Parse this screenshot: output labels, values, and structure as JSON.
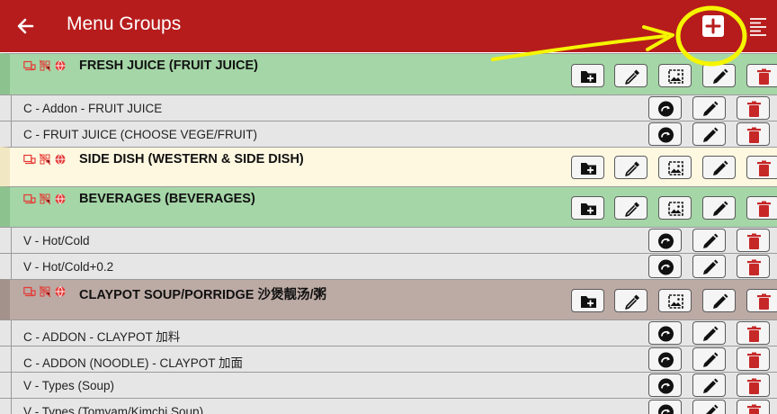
{
  "header": {
    "title": "Menu Groups",
    "back_icon": "arrow-left-icon",
    "add_icon": "plus-box-icon",
    "sort_icon": "sort-lines-icon"
  },
  "colors": {
    "toolbar": "#b71c1c",
    "group_green": "#a5d6a7",
    "group_cream": "#fff8e1",
    "group_taupe": "#bcaaa4",
    "delete": "#c62828",
    "annotation": "#f5f500"
  },
  "rows": [
    {
      "kind": "group",
      "label": "FRESH JUICE  (FRUIT JUICE)"
    },
    {
      "kind": "sub",
      "label": "C - Addon - FRUIT JUICE"
    },
    {
      "kind": "sub",
      "label": "C - FRUIT JUICE (CHOOSE VEGE/FRUIT)"
    },
    {
      "kind": "group",
      "label": "SIDE DISH  (WESTERN & SIDE DISH)"
    },
    {
      "kind": "group",
      "label": "BEVERAGES  (BEVERAGES)"
    },
    {
      "kind": "sub",
      "label": "V - Hot/Cold"
    },
    {
      "kind": "sub",
      "label": "V - Hot/Cold+0.2"
    },
    {
      "kind": "group",
      "label": "CLAYPOT SOUP/PORRIDGE 沙煲靓汤/粥"
    },
    {
      "kind": "sub",
      "label": "C - ADDON - CLAYPOT 加料"
    },
    {
      "kind": "sub",
      "label": "C - ADDON (NOODLE) - CLAYPOT 加面"
    },
    {
      "kind": "sub",
      "label": "V - Types (Soup)"
    },
    {
      "kind": "sub",
      "label": "V - Types (Tomyam/Kimchi Soup)"
    }
  ],
  "icons": {
    "group_status": [
      "pos-terminal-icon",
      "qr-code-icon",
      "globe-icon"
    ],
    "group_actions": [
      "add-folder-icon",
      "eyedropper-icon",
      "image-icon",
      "edit-pencil-icon",
      "delete-trash-icon"
    ],
    "sub_actions": [
      "redo-arrow-icon",
      "edit-pencil-icon",
      "delete-trash-icon"
    ]
  }
}
